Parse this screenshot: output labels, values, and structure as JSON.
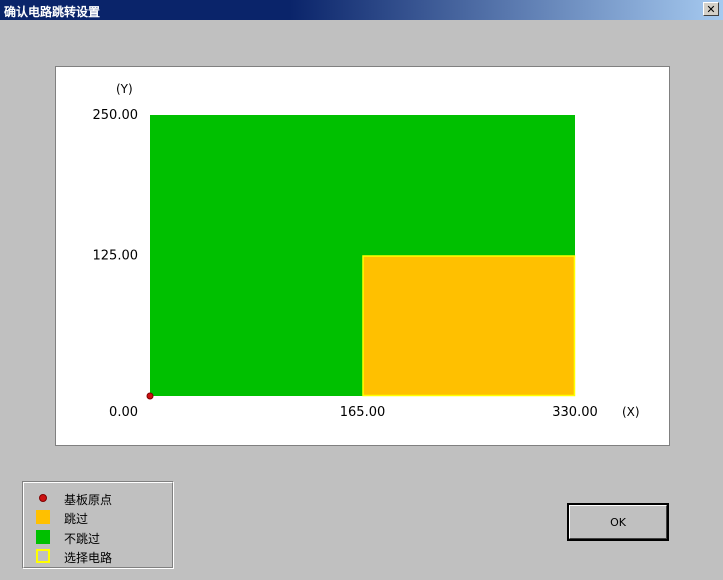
{
  "window": {
    "title": "确认电路跳转设置",
    "close_glyph": "✕"
  },
  "chart_data": {
    "type": "area",
    "xlabel": "(X)",
    "ylabel": "(Y)",
    "x_ticks": [
      "0.00",
      "165.00",
      "330.00"
    ],
    "y_ticks": [
      "0.00",
      "125.00",
      "250.00"
    ],
    "xlim": [
      0,
      330
    ],
    "ylim": [
      0,
      250
    ],
    "board": {
      "x0": 0,
      "y0": 0,
      "x1": 330,
      "y1": 250,
      "color": "#00c000"
    },
    "regions": [
      {
        "name": "跳过",
        "x0": 165,
        "y0": 0,
        "x1": 330,
        "y1": 125,
        "color": "#ffc000",
        "stroke": "#ffff00"
      }
    ],
    "origin": {
      "x": 0,
      "y": 0,
      "color": "#cc1111"
    }
  },
  "legend": {
    "items": [
      {
        "label": "基板原点",
        "swatch": "dot",
        "color": "#cc1111"
      },
      {
        "label": "跳过",
        "swatch": "fill",
        "color": "#ffc000"
      },
      {
        "label": "不跳过",
        "swatch": "fill",
        "color": "#00c000"
      },
      {
        "label": "选择电路",
        "swatch": "outline",
        "color": "#ffff00"
      }
    ]
  },
  "buttons": {
    "ok_label": "OK"
  }
}
